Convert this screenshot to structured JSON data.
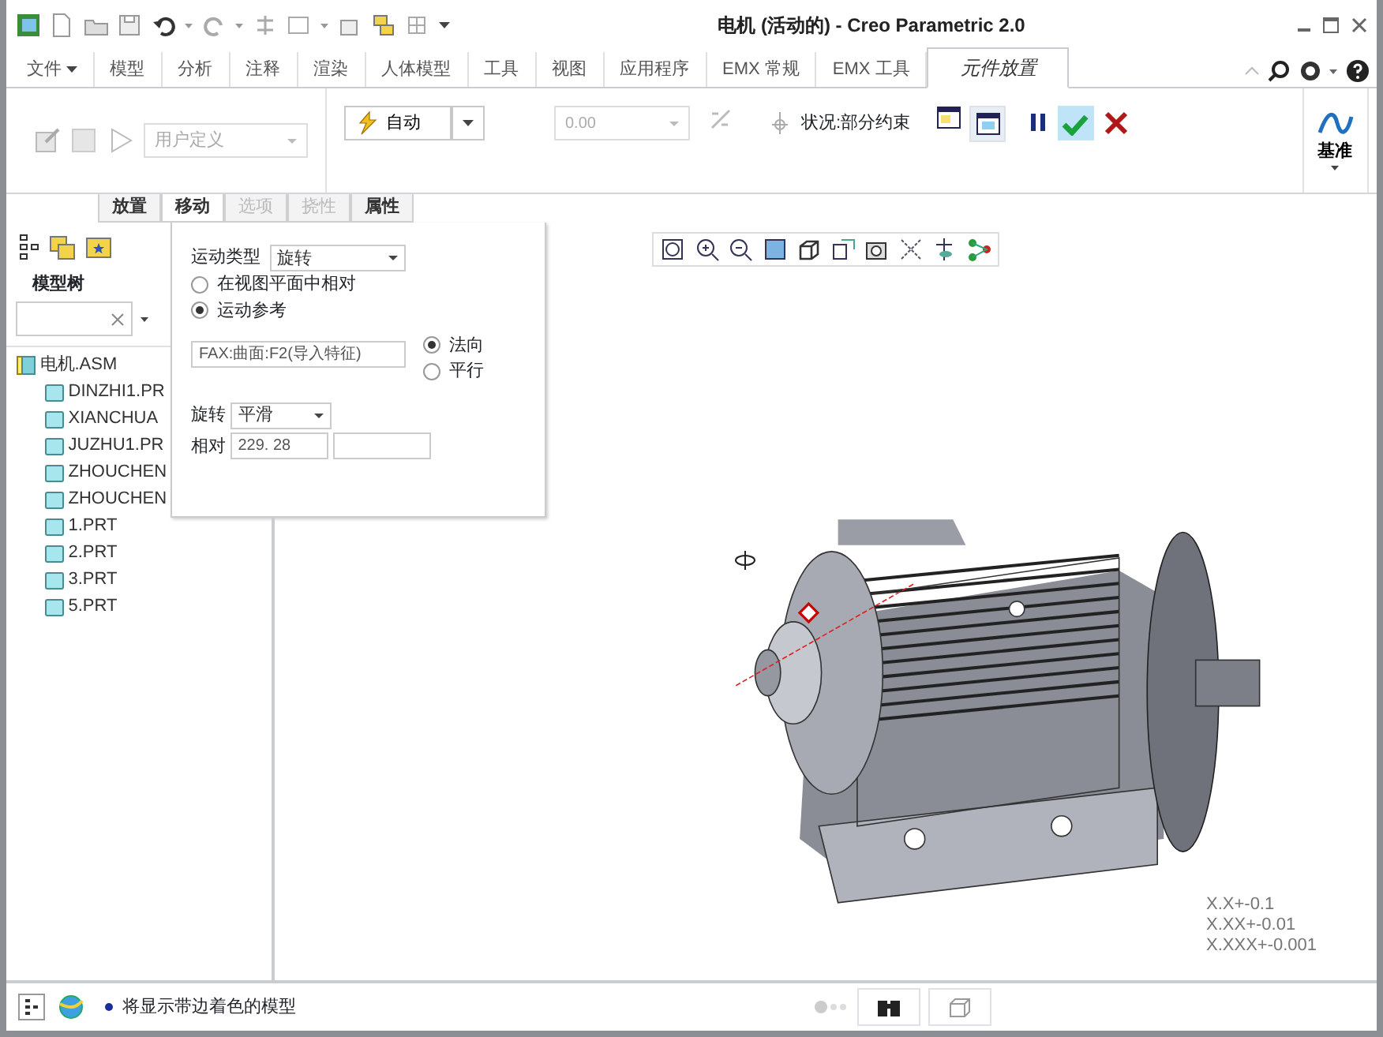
{
  "window": {
    "title": "电机 (活动的) - Creo Parametric 2.0"
  },
  "ribbon_tabs": [
    {
      "label": "文件",
      "selected": false,
      "kind": "menu"
    },
    {
      "label": "模型",
      "selected": false,
      "kind": "tab"
    },
    {
      "label": "分析",
      "selected": false,
      "kind": "tab"
    },
    {
      "label": "注释",
      "selected": false,
      "kind": "tab"
    },
    {
      "label": "渲染",
      "selected": false,
      "kind": "tab"
    },
    {
      "label": "人体模型",
      "selected": false,
      "kind": "tab"
    },
    {
      "label": "工具",
      "selected": false,
      "kind": "tab"
    },
    {
      "label": "视图",
      "selected": false,
      "kind": "tab"
    },
    {
      "label": "应用程序",
      "selected": false,
      "kind": "tab"
    },
    {
      "label": "EMX 常规",
      "selected": false,
      "kind": "tab"
    },
    {
      "label": "EMX 工具",
      "selected": false,
      "kind": "tab"
    },
    {
      "label": "元件放置",
      "selected": true,
      "kind": "tab"
    }
  ],
  "ribbon": {
    "constraint_dropdown": {
      "value": "用户定义",
      "disabled": true
    },
    "auto_dropdown": {
      "value": "自动"
    },
    "offset_field": {
      "value": "0.00",
      "disabled": true
    },
    "status_text": "状况:部分约束",
    "datum_button": {
      "label": "基准"
    }
  },
  "dashboard_tabs": [
    {
      "label": "放置",
      "selected": false,
      "disabled": false
    },
    {
      "label": "移动",
      "selected": true,
      "disabled": false
    },
    {
      "label": "选项",
      "selected": false,
      "disabled": true
    },
    {
      "label": "挠性",
      "selected": false,
      "disabled": true
    },
    {
      "label": "属性",
      "selected": false,
      "disabled": false
    }
  ],
  "model_tree": {
    "title": "模型树",
    "items": [
      {
        "label": "电机.ASM",
        "kind": "assembly",
        "children": [
          {
            "label": "DINZHI1.PR",
            "kind": "part"
          },
          {
            "label": "XIANCHUA",
            "kind": "part"
          },
          {
            "label": "JUZHU1.PR",
            "kind": "part"
          },
          {
            "label": "ZHOUCHEN",
            "kind": "part"
          },
          {
            "label": "ZHOUCHEN",
            "kind": "part"
          },
          {
            "label": "1.PRT",
            "kind": "part"
          },
          {
            "label": "2.PRT",
            "kind": "part"
          },
          {
            "label": "3.PRT",
            "kind": "part"
          },
          {
            "label": "5.PRT",
            "kind": "part"
          }
        ]
      }
    ]
  },
  "move_panel": {
    "motion_type": {
      "label": "运动类型",
      "value": "旋转"
    },
    "motion_options": [
      {
        "label": "在视图平面中相对",
        "selected": false
      },
      {
        "label": "运动参考",
        "selected": true
      }
    ],
    "reference_field": {
      "value": "FAX:曲面:F2(导入特征)"
    },
    "direction_options": [
      {
        "label": "法向",
        "selected": true
      },
      {
        "label": "平行",
        "selected": false
      }
    ],
    "rotation": {
      "label": "旋转",
      "value": "平滑"
    },
    "relative": {
      "label": "相对",
      "value": "229. 28"
    }
  },
  "viewport": {
    "tolerances": [
      "X.X+-0.1",
      "X.XX+-0.01",
      "X.XXX+-0.001"
    ]
  },
  "status_bar": {
    "message": "将显示带边着色的模型"
  }
}
